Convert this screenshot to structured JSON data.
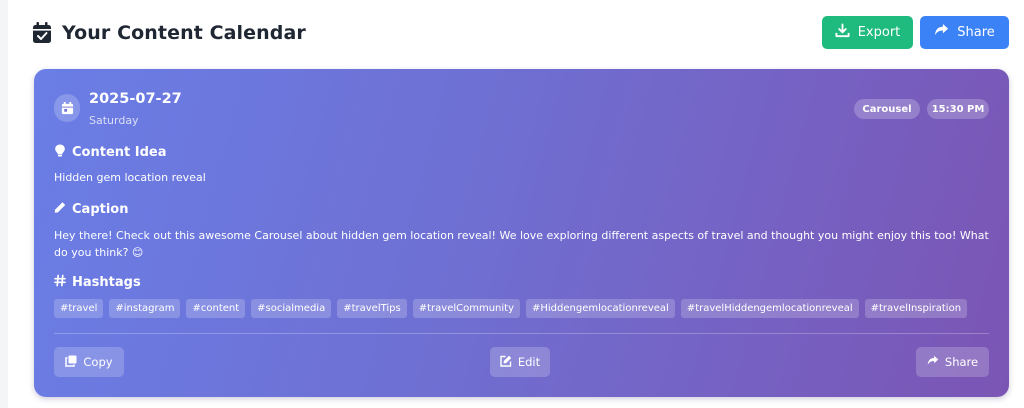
{
  "header": {
    "title": "Your Content Calendar",
    "export_label": "Export",
    "share_label": "Share"
  },
  "card": {
    "date": "2025-07-27",
    "weekday": "Saturday",
    "content_type": "Carousel",
    "time": "15:30 PM",
    "idea_heading": "Content Idea",
    "idea_text": "Hidden gem location reveal",
    "caption_heading": "Caption",
    "caption_text": "Hey there! Check out this awesome Carousel about hidden gem location reveal! We love exploring different aspects of travel and thought you might enjoy this too! What do you think? 😊",
    "hashtags_heading": "Hashtags",
    "hashtags": [
      "#travel",
      "#instagram",
      "#content",
      "#socialmedia",
      "#travelTips",
      "#travelCommunity",
      "#Hiddengemlocationreveal",
      "#travelHiddengemlocationreveal",
      "#travelInspiration"
    ],
    "copy_label": "Copy",
    "edit_label": "Edit",
    "share_label": "Share"
  },
  "colors": {
    "export": "#1fba7d",
    "share": "#3b82f6",
    "card_gradient_start": "#6a7ee6",
    "card_gradient_end": "#7b55b4"
  },
  "icons": {
    "title": "calendar-check-icon",
    "export": "download-icon",
    "share": "share-arrow-icon",
    "date": "calendar-icon",
    "idea": "lightbulb-icon",
    "caption": "pencil-icon",
    "hashtags": "hashtag-icon",
    "copy": "copy-icon",
    "edit": "edit-icon"
  }
}
